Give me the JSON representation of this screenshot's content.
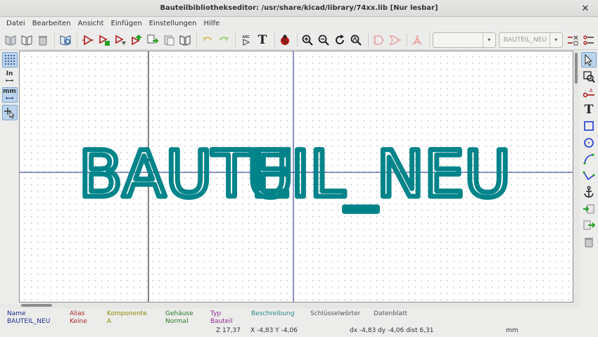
{
  "window": {
    "title": "Bauteilbibliothekseditor: /usr/share/kicad/library/74xx.lib [Nur lesbar]",
    "close_glyph": "✕"
  },
  "menu": [
    "Datei",
    "Bearbeiten",
    "Ansicht",
    "Einfügen",
    "Einstellungen",
    "Hilfe"
  ],
  "toolbar": {
    "combo_unit_value": "",
    "combo_part_value": "BAUTEIL_NEU",
    "combo_arrow": "▾",
    "text_tool_glyph": "T",
    "abc_label": "ABC"
  },
  "left_toolbar": {
    "in_label": "In",
    "mm_label": "mm"
  },
  "canvas": {
    "component_text": "BAUTEIL_NEU",
    "ref_text": "U",
    "text_color": "#00848a",
    "axis_color": "#1c2c8c"
  },
  "info": {
    "name": {
      "label": "Name",
      "value": "BAUTEIL_NEU",
      "color": "#1c2c8c"
    },
    "alias": {
      "label": "Alias",
      "value": "Keine",
      "color": "#a52a2a"
    },
    "komponente": {
      "label": "Komponente",
      "value": "A",
      "color": "#8a8a00"
    },
    "gehaeuse": {
      "label": "Gehäuse",
      "value": "Normal",
      "color": "#2a7a2a"
    },
    "typ": {
      "label": "Typ",
      "value": "Bauteil",
      "color": "#8a2a8a"
    },
    "beschreibung": {
      "label": "Beschreibung",
      "value": "",
      "color": "#2a8a8a"
    },
    "schluesselwoerter": {
      "label": "Schlüsselwörter",
      "value": "",
      "color": "#555555"
    },
    "datenblatt": {
      "label": "Datenblatt",
      "value": "",
      "color": "#555555"
    }
  },
  "status": {
    "zoom": "Z 17,37",
    "xy": "X -4,83  Y -4,06",
    "delta": "dx -4,83  dy -4,06  dist 6,31",
    "units": "mm"
  }
}
